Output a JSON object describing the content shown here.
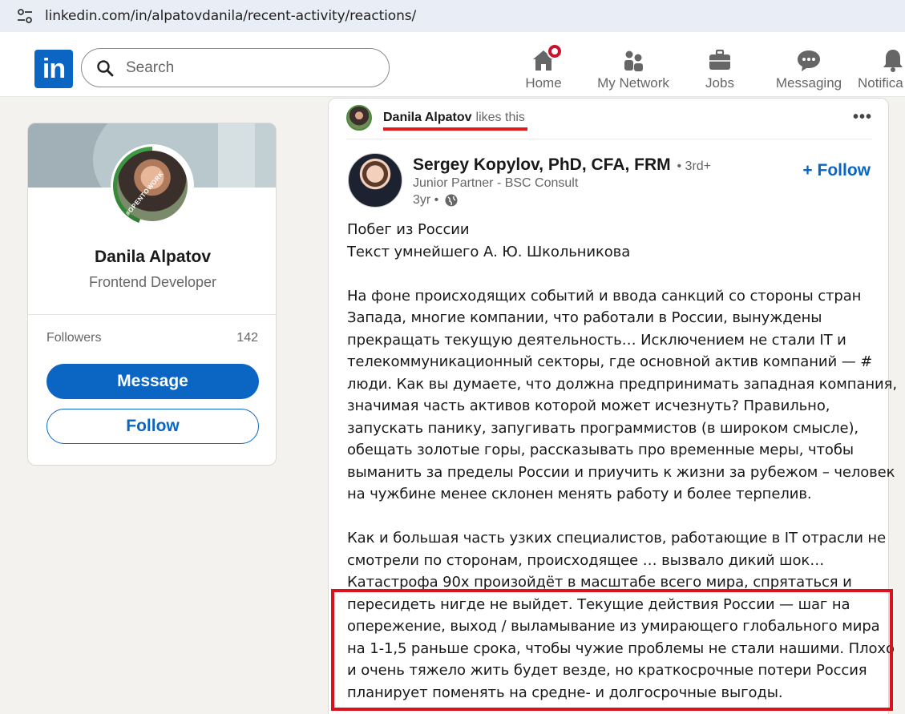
{
  "browser": {
    "url": "linkedin.com/in/alpatovdanila/recent-activity/reactions/"
  },
  "header": {
    "logo_text": "in",
    "search_placeholder": "Search",
    "nav": {
      "home": "Home",
      "network": "My Network",
      "jobs": "Jobs",
      "messaging": "Messaging",
      "notifications": "Notifica"
    }
  },
  "profile": {
    "badge_text": "#OPENTOWORK",
    "name": "Danila Alpatov",
    "title": "Frontend Developer",
    "followers_label": "Followers",
    "followers_count": "142",
    "message_label": "Message",
    "follow_label": "Follow"
  },
  "post": {
    "activity_name": "Danila Alpatov",
    "activity_action": "likes this",
    "more": "•••",
    "author_name": "Sergey Kopylov, PhD, CFA, FRM",
    "author_degree": "• 3rd+",
    "author_headline": "Junior Partner - BSC Consult",
    "author_time": "3yr •",
    "follow_label": "+ Follow",
    "lines": [
      "Побег из России",
      "Текст умнейшего А. Ю. Школьникова",
      "",
      "На фоне происходящих событий и ввода санкций со стороны стран",
      "Запада, многие компании, что работали в России, вынуждены",
      "прекращать текущую деятельность… Исключением не стали IT и",
      "телекоммуникационный секторы, где основной актив компаний — #",
      "люди. Как вы думаете, что должна предпринимать западная компания,",
      "значимая часть активов которой может исчезнуть? Правильно,",
      "запускать панику, запугивать программистов (в широком смысле),",
      "обещать золотые горы, рассказывать про временные меры, чтобы",
      "выманить за пределы России и приучить к жизни за рубежом – человек",
      "на чужбине менее склонен менять работу и более терпелив.",
      "",
      "Как и большая часть узких специалистов, работающие в IT отрасли не",
      "смотрели по сторонам, происходящее … вызвало дикий шок…",
      "Катастрофа 90х произойдёт в масштабе всего мира, спрятаться и",
      "пересидеть нигде не выйдет. Текущие действия России — шаг на",
      "опережение, выход / выламывание из умирающего глобального мира",
      "на 1-1,5 раньше срока, чтобы чужие проблемы не стали нашими. Плохо",
      "и очень тяжело жить будет везде, но краткосрочные потери Россия",
      "планирует поменять на средне- и долгосрочные выгоды."
    ]
  },
  "colors": {
    "brand": "#0a66c2",
    "annotation_red": "#d9121b",
    "notification_badge": "#cb112d"
  }
}
